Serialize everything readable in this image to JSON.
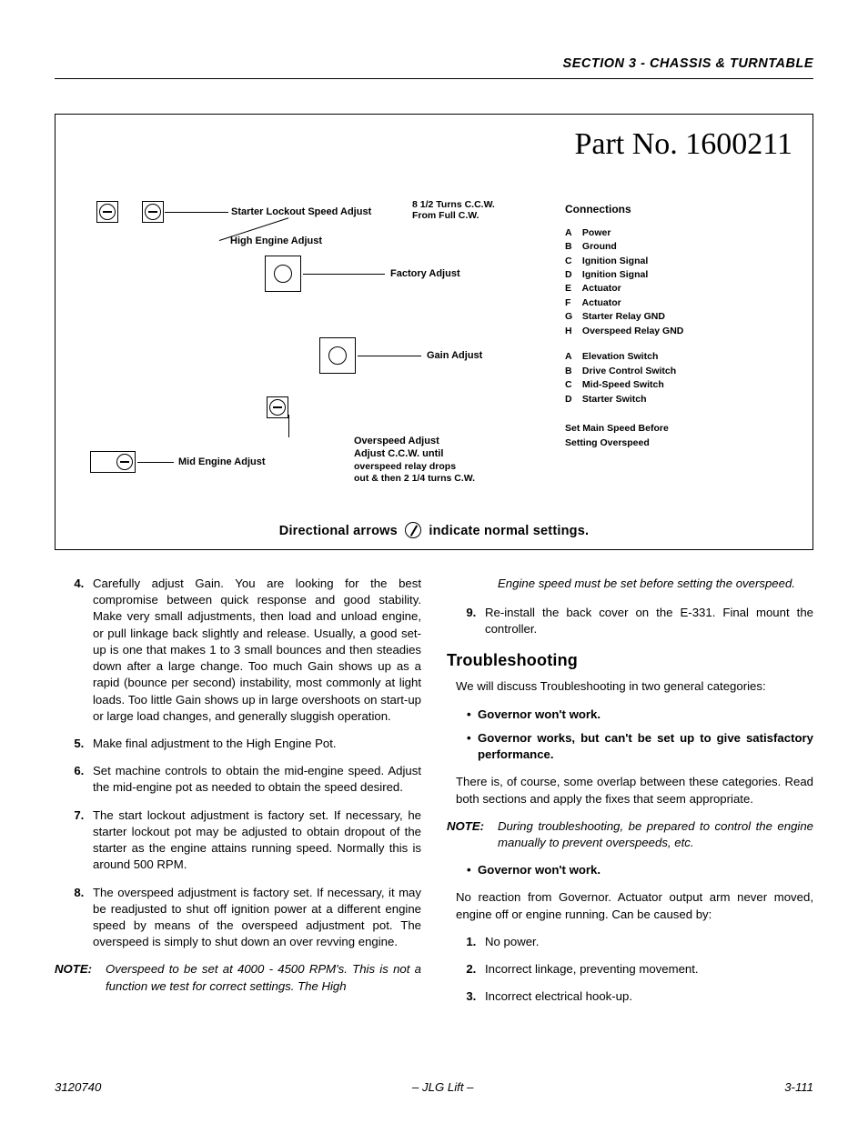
{
  "header": {
    "section": "SECTION 3 - CHASSIS & TURNTABLE"
  },
  "figure": {
    "part_no": "Part No. 1600211",
    "starter_lockout": "Starter Lockout Speed Adjust",
    "starter_lockout_note_1": "8 1/2 Turns C.C.W.",
    "starter_lockout_note_2": "From Full C.W.",
    "high_engine": "High Engine Adjust",
    "factory": "Factory Adjust",
    "gain": "Gain Adjust",
    "mid_engine": "Mid Engine Adjust",
    "overspeed": "Overspeed Adjust",
    "overspeed_note_1": "Adjust C.C.W. until",
    "overspeed_note_2": "overspeed relay drops",
    "overspeed_note_3": "out & then 2 1/4 turns C.W.",
    "connections_title": "Connections",
    "conn1": [
      {
        "k": "A",
        "v": "Power"
      },
      {
        "k": "B",
        "v": "Ground"
      },
      {
        "k": "C",
        "v": "Ignition Signal"
      },
      {
        "k": "D",
        "v": "Ignition Signal"
      },
      {
        "k": "E",
        "v": "Actuator"
      },
      {
        "k": "F",
        "v": "Actuator"
      },
      {
        "k": "G",
        "v": "Starter Relay GND"
      },
      {
        "k": "H",
        "v": "Overspeed Relay GND"
      }
    ],
    "conn2": [
      {
        "k": "A",
        "v": "Elevation Switch"
      },
      {
        "k": "B",
        "v": "Drive Control Switch"
      },
      {
        "k": "C",
        "v": "Mid-Speed Switch"
      },
      {
        "k": "D",
        "v": "Starter Switch"
      }
    ],
    "set_main_1": "Set Main Speed Before",
    "set_main_2": "Setting Overspeed",
    "caption_a": "Directional arrows",
    "caption_b": "indicate normal settings."
  },
  "steps_left": [
    "Carefully adjust Gain. You are looking for the best compromise between quick response and good stability. Make very small adjustments, then load and unload engine, or pull linkage back slightly and release. Usually, a good set-up is one that makes 1 to 3 small bounces and then steadies down after a large change. Too much Gain shows up as a rapid (bounce per second) instability, most commonly at light loads. Too little Gain shows up in large overshoots on start-up or large load changes, and generally sluggish operation.",
    "Make final adjustment to the High Engine Pot.",
    "Set machine controls to obtain the mid-engine speed. Adjust the mid-engine pot as needed to obtain the speed desired.",
    "The start lockout adjustment is factory set. If necessary, he starter lockout pot may be adjusted to obtain dropout of the starter as the engine attains running speed. Normally this is around 500 RPM.",
    "The overspeed adjustment is factory set. If necessary, it may be readjusted to shut off ignition power at a different engine speed by means of the overspeed adjustment pot. The overspeed is simply to shut down an over revving engine."
  ],
  "note_label": "NOTE:",
  "note1": "Overspeed to be set at 4000 - 4500 RPM's. This is not a function we test for correct settings. The High",
  "note1_cont": "Engine speed must be set before setting the overspeed.",
  "steps_right": [
    "Re-install the back cover on the E-331. Final mount the controller."
  ],
  "trouble_heading": "Troubleshooting",
  "trouble_intro": "We will discuss Troubleshooting in two general categories:",
  "trouble_bullets": [
    "Governor won't work.",
    "Governor works, but can't be set up to give satisfactory performance."
  ],
  "trouble_overlap": "There is, of course, some overlap between these categories. Read both sections and apply the fixes that seem appropriate.",
  "note2": "During troubleshooting, be prepared to control the engine manually to prevent overspeeds, etc.",
  "gov_wont": "Governor won't work.",
  "gov_wont_desc": "No reaction from Governor. Actuator output arm never moved, engine off or engine running. Can be caused by:",
  "gov_causes": [
    "No power.",
    "Incorrect linkage, preventing movement.",
    "Incorrect electrical hook-up."
  ],
  "footer": {
    "left": "3120740",
    "center": "– JLG Lift –",
    "right": "3-111"
  }
}
